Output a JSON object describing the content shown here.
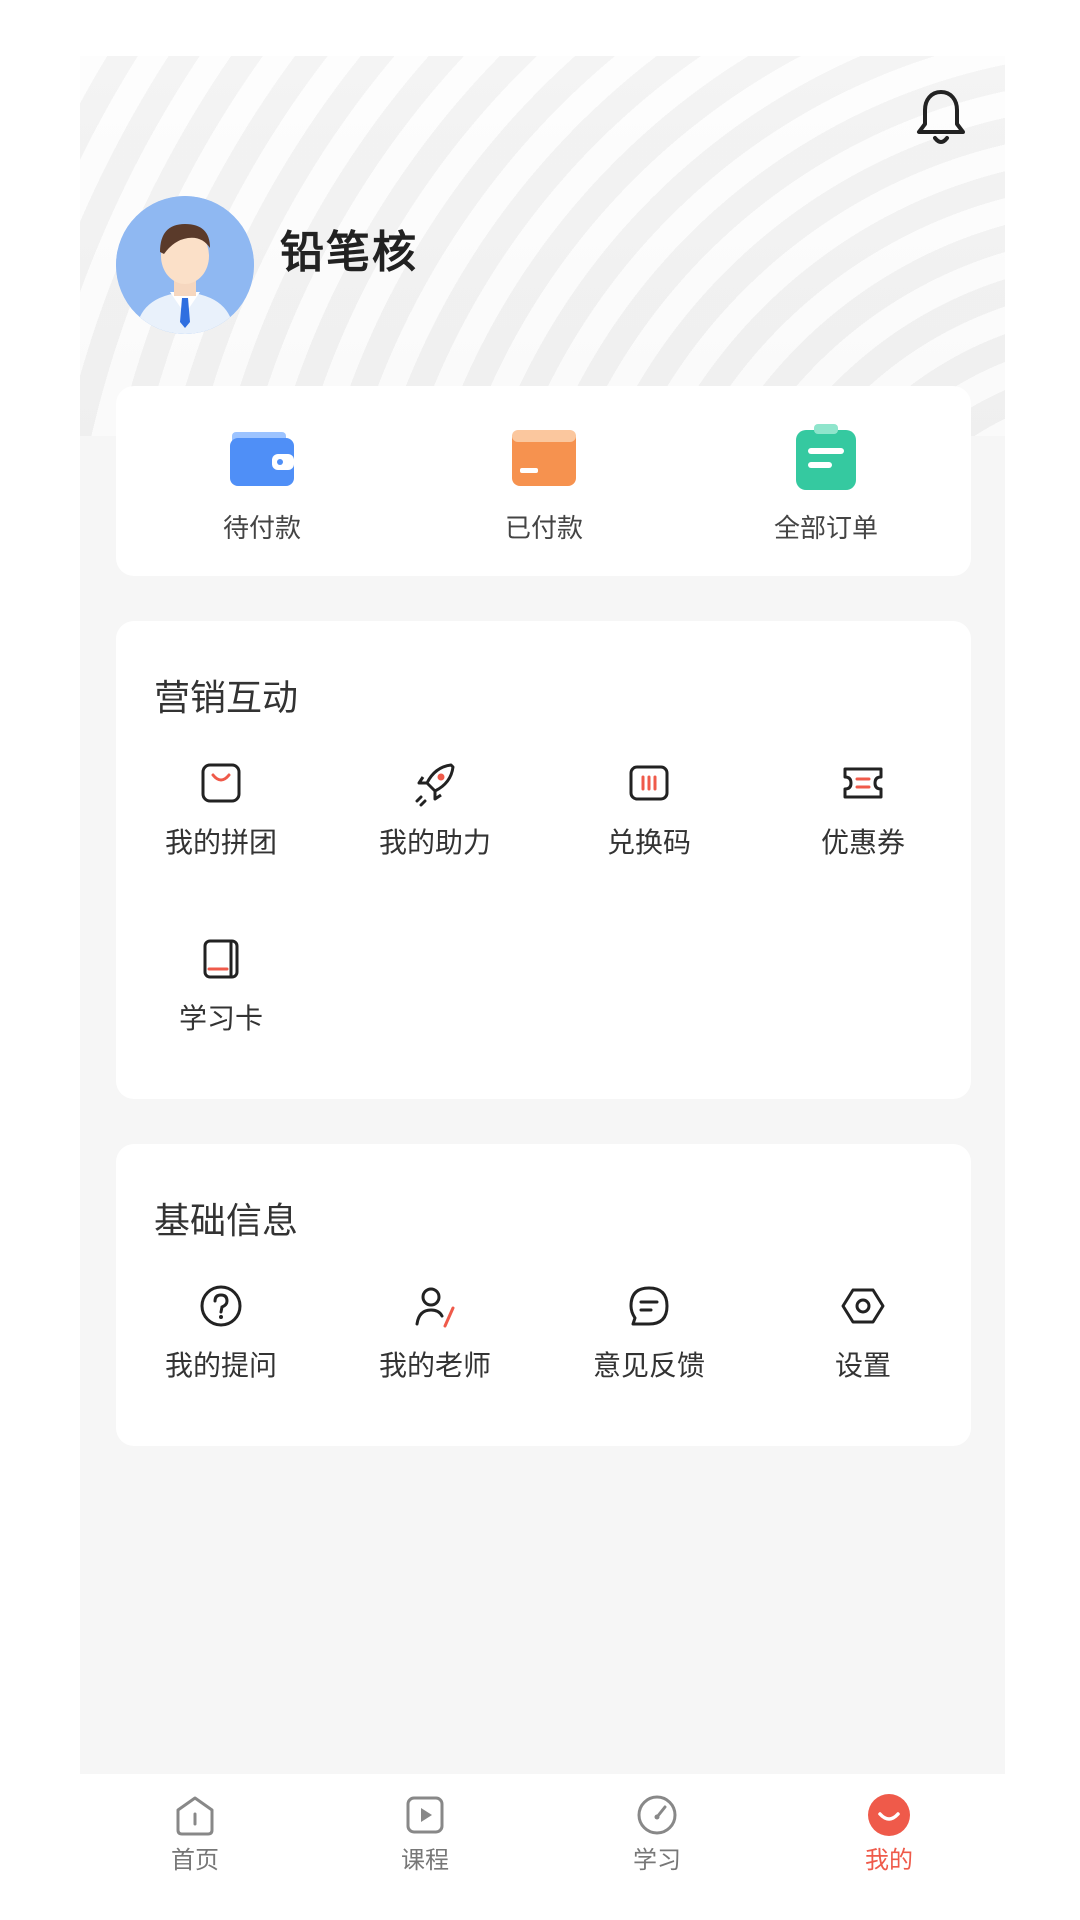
{
  "profile": {
    "username": "铅笔核"
  },
  "orders": [
    {
      "label": "待付款"
    },
    {
      "label": "已付款"
    },
    {
      "label": "全部订单"
    }
  ],
  "marketing": {
    "title": "营销互动",
    "items": [
      {
        "label": "我的拼团"
      },
      {
        "label": "我的助力"
      },
      {
        "label": "兑换码"
      },
      {
        "label": "优惠券"
      },
      {
        "label": "学习卡"
      }
    ]
  },
  "basic": {
    "title": "基础信息",
    "items": [
      {
        "label": "我的提问"
      },
      {
        "label": "我的老师"
      },
      {
        "label": "意见反馈"
      },
      {
        "label": "设置"
      }
    ]
  },
  "tabbar": {
    "items": [
      {
        "label": "首页"
      },
      {
        "label": "课程"
      },
      {
        "label": "学习"
      },
      {
        "label": "我的"
      }
    ],
    "active_index": 3
  },
  "colors": {
    "accent": "#ef5a4a",
    "page_bg": "#f6f6f6",
    "card_bg": "#ffffff",
    "wallet": "#4f8ff7",
    "card_orange": "#f6924f",
    "clipboard_green": "#35c9a0"
  }
}
